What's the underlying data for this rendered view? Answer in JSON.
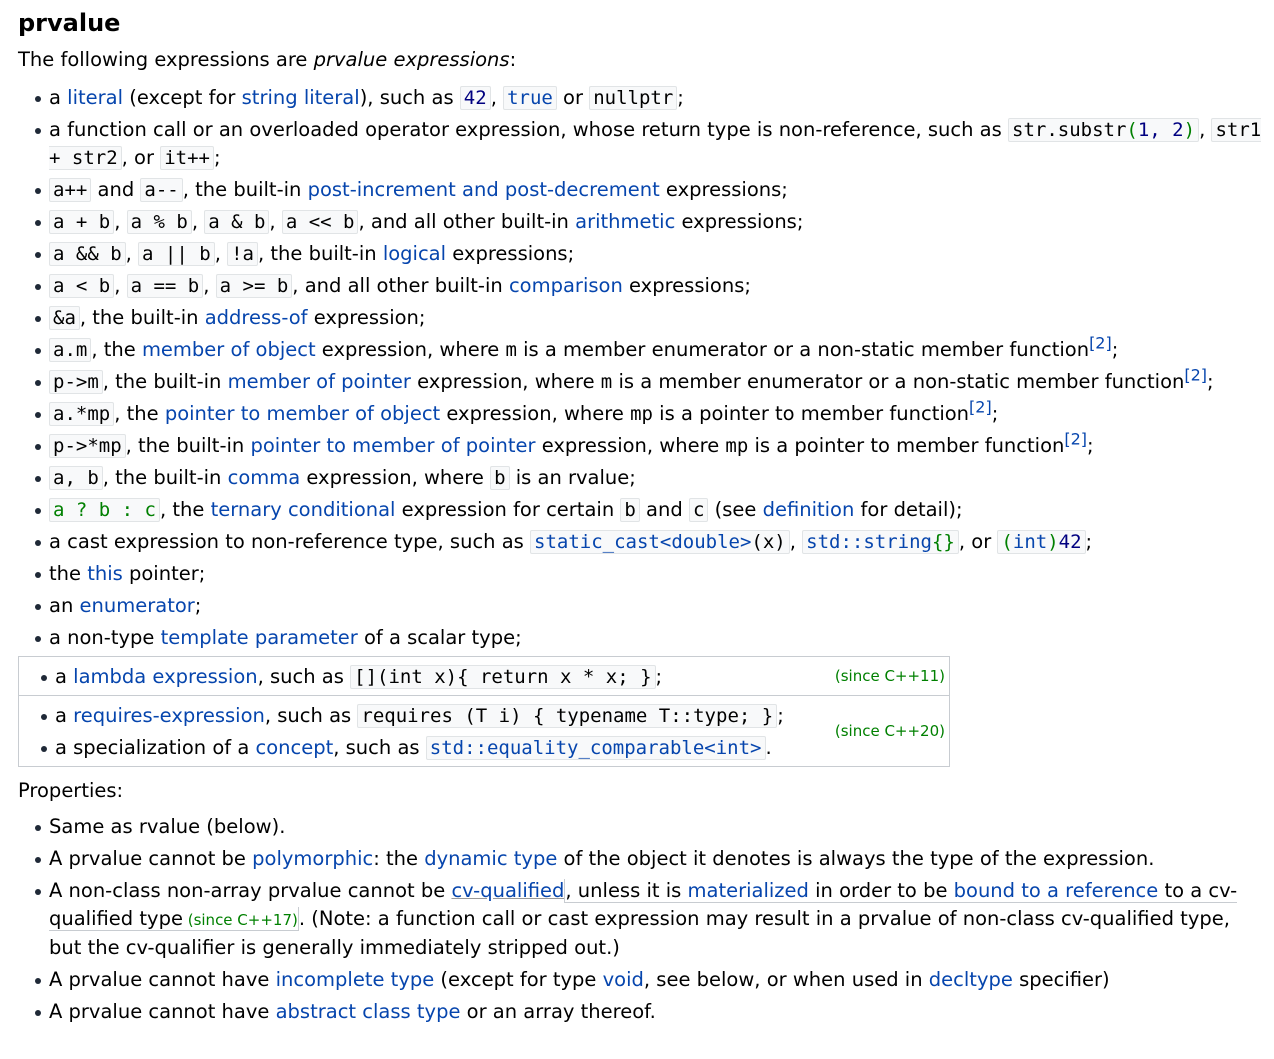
{
  "title": "prvalue",
  "intro": {
    "prefix": "The following expressions are ",
    "em": "prvalue expressions",
    "suffix": ":"
  },
  "items": {
    "i1": {
      "a": "a ",
      "link": "literal",
      "b": " (except for ",
      "link2": "string literal",
      "c": "), such as ",
      "c1": "42",
      "sep1": ", ",
      "c2": "true",
      "sep2": " or ",
      "c3": "nullptr",
      "end": ";"
    },
    "i2": {
      "text": "a function call or an overloaded operator expression, whose return type is non-reference, such as ",
      "c1a": "str.substr",
      "c1b": "(",
      "c1c": "1, 2",
      "c1d": ")",
      "sep1": ", ",
      "c2": "str1 + str2",
      "sep2": ", or ",
      "c3": "it++",
      "end": ";"
    },
    "i3": {
      "c1": "a++",
      "and": " and ",
      "c2": "a--",
      "text": ", the built-in ",
      "link": "post-increment and post-decrement",
      "end": " expressions;"
    },
    "i4": {
      "c1": "a + b",
      "c2": "a % b",
      "c3": "a & b",
      "c4": "a << b",
      "text": ", and all other built-in ",
      "link": "arithmetic",
      "end": " expressions;"
    },
    "i5": {
      "c1": "a && b",
      "c2": "a || b",
      "c3": "!a",
      "text": ", the built-in ",
      "link": "logical",
      "end": " expressions;"
    },
    "i6": {
      "c1": "a < b",
      "c2": "a == b",
      "c3": "a >= b",
      "text": ", and all other built-in ",
      "link": "comparison",
      "end": " expressions;"
    },
    "i7": {
      "c1": "&a",
      "text": ", the built-in ",
      "link": "address-of",
      "end": " expression;"
    },
    "i8": {
      "c1": "a.m",
      "text": ", the ",
      "link": "member of object",
      "mid": " expression, where ",
      "m": "m",
      "end": " is a member enumerator or a non-static member function",
      "sup": "[2]",
      "semi": ";"
    },
    "i9": {
      "c1": "p->m",
      "text": ", the built-in ",
      "link": "member of pointer",
      "mid": " expression, where ",
      "m": "m",
      "end": " is a member enumerator or a non-static member function",
      "sup": "[2]",
      "semi": ";"
    },
    "i10": {
      "c1": "a.*mp",
      "text": ", the ",
      "link": "pointer to member of object",
      "mid": " expression, where ",
      "m": "mp",
      "end": " is a pointer to member function",
      "sup": "[2]",
      "semi": ";"
    },
    "i11": {
      "c1": "p->*mp",
      "text": ", the built-in ",
      "link": "pointer to member of pointer",
      "mid": " expression, where ",
      "m": "mp",
      "end": " is a pointer to member function",
      "sup": "[2]",
      "semi": ";"
    },
    "i12": {
      "c1": "a, b",
      "text": ", the built-in ",
      "link": "comma",
      "mid": " expression, where ",
      "c2": "b",
      "end": " is an rvalue;"
    },
    "i13": {
      "c1": "a ? b : c",
      "text": ", the ",
      "link1": "ternary",
      "sp": " ",
      "link": "conditional",
      "mid": " expression for certain ",
      "c2": "b",
      "and": " and ",
      "c3": "c",
      "see": " (see ",
      "link2": "definition",
      "end": " for detail);"
    },
    "i14": {
      "text": "a cast expression to non-reference type, such as ",
      "c1a": "static_cast",
      "c1b": "<double>",
      "c1c": "(x)",
      "sep": ", ",
      "c2a": "std::",
      "c2b": "string",
      "c2c": "{}",
      "or": ", or ",
      "c3a": "(",
      "c3b": "int",
      "c3c": ")",
      "c3d": "42",
      "end": ";"
    },
    "i15": {
      "a": "the ",
      "kw": "this",
      "end": " pointer;"
    },
    "i16": {
      "a": "an ",
      "link": "enumerator",
      "end": ";"
    },
    "i17": {
      "a": "a non-type ",
      "link": "template parameter",
      "end": " of a scalar type;"
    }
  },
  "versioned": {
    "v1": {
      "a": "a ",
      "link": "lambda expression",
      "b": ", such as ",
      "code": "[](int x){ return x * x; }",
      "end": ";",
      "rev": "(since C++11)"
    },
    "v2": {
      "a": "a ",
      "link": "requires-expression",
      "b": ", such as ",
      "code": "requires (T i) { typename T::type; }",
      "end": ";"
    },
    "v3": {
      "a": "a specialization of a ",
      "link": "concept",
      "b": ", such as ",
      "code": "std::equality_comparable<int>",
      "end": ".",
      "rev": "(since C++20)"
    }
  },
  "properties_label": "Properties:",
  "properties": {
    "p1": "Same as rvalue (below).",
    "p2": {
      "a": "A prvalue cannot be ",
      "link1": "polymorphic",
      "b": ": the ",
      "link2": "dynamic type",
      "c": " of the object it denotes is always the type of the expression."
    },
    "p3": {
      "a": "A non-class non-array prvalue cannot be ",
      "link1": "cv-qualified",
      "b": ", unless it is ",
      "link2": "materialized",
      "c": " in order to be ",
      "link3": "bound to a reference",
      "d": " to a cv-qualified type",
      "since": " (since C++17)",
      "e": ". (Note: a function call or cast expression may result in a prvalue of non-class cv-qualified type, but the cv-qualifier is generally immediately stripped out.)"
    },
    "p4": {
      "a": "A prvalue cannot have ",
      "link1": "incomplete type",
      "b": " (except for type ",
      "link2": "void",
      "c": ", see below, or when used in ",
      "link3": "decltype",
      "d": " specifier)"
    },
    "p5": {
      "a": "A prvalue cannot have ",
      "link1": "abstract class type",
      "b": " or an array thereof."
    }
  }
}
